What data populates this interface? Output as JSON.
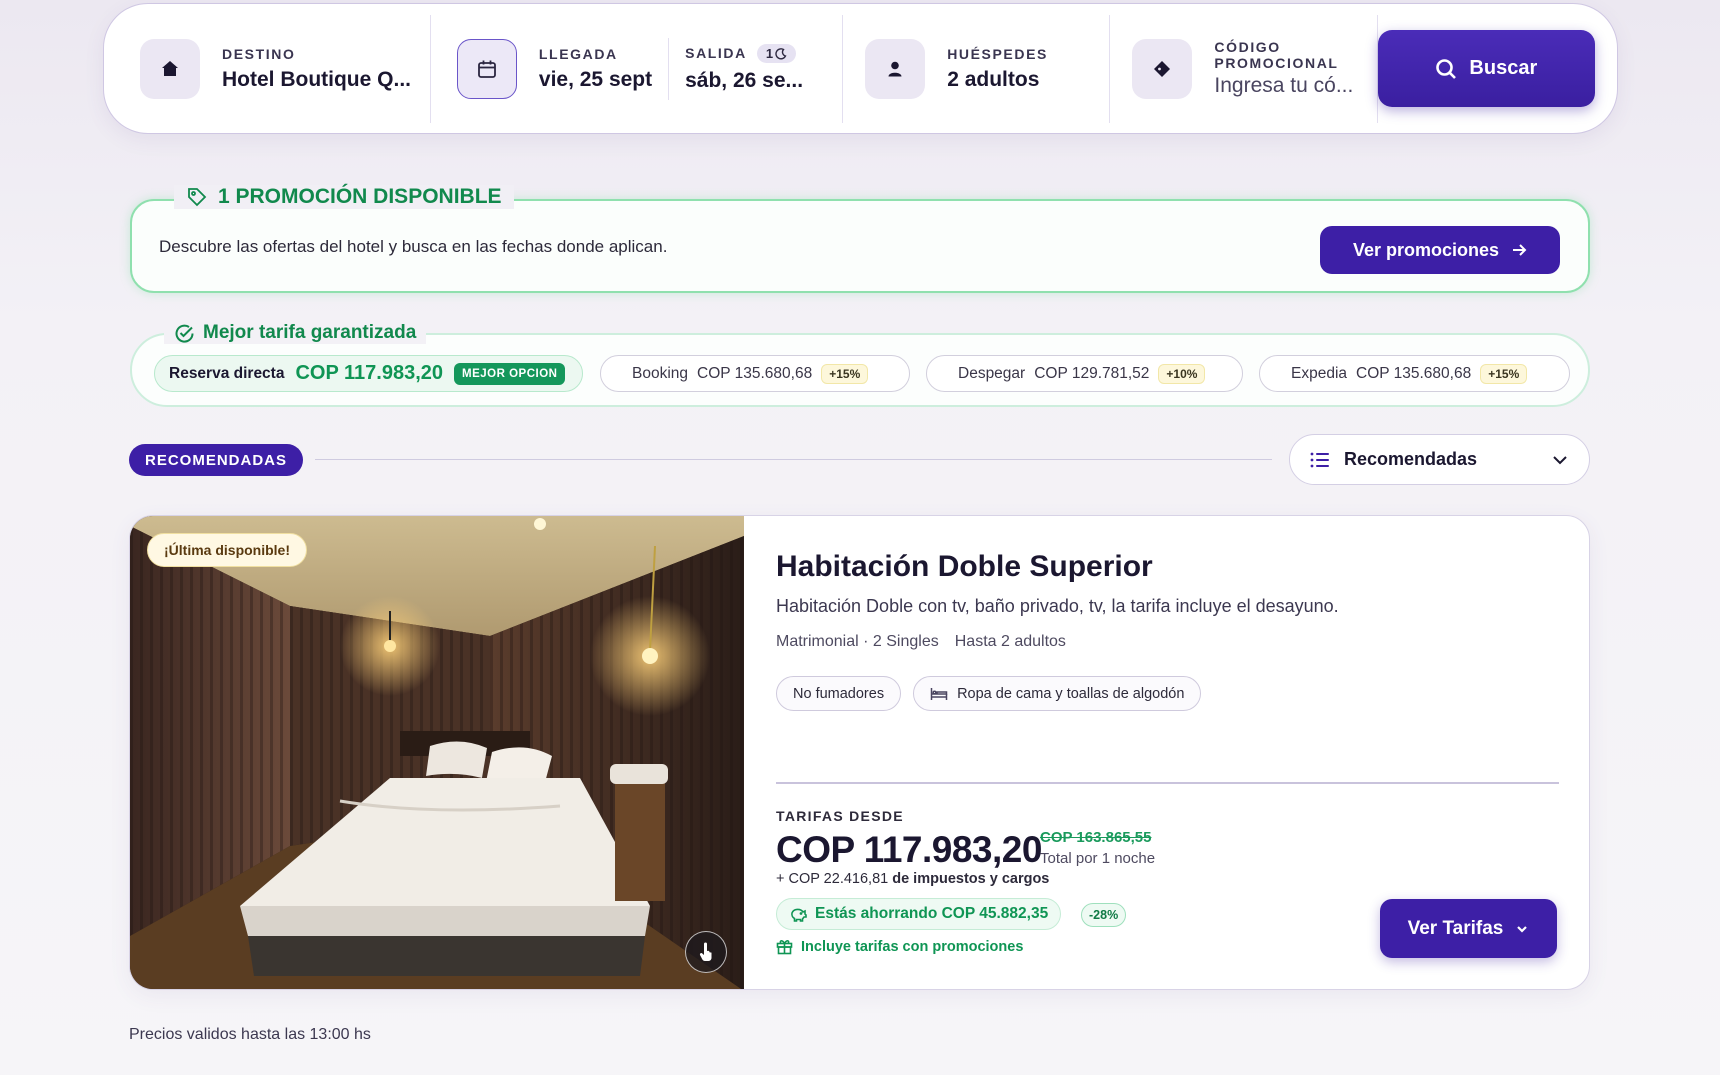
{
  "search": {
    "destination": {
      "label": "DESTINO",
      "value": "Hotel Boutique Q...",
      "icon": "home-icon"
    },
    "arrival": {
      "label": "LLEGADA",
      "value": "vie, 25 sept",
      "icon": "calendar-icon"
    },
    "departure": {
      "label": "SALIDA",
      "value": "sáb, 26 se...",
      "nights": "1",
      "nights_icon": "moon-icon"
    },
    "guests": {
      "label": "HUÉSPEDES",
      "value": "2 adultos",
      "icon": "user-icon"
    },
    "promo_code": {
      "label_line1": "CÓDIGO",
      "label_line2": "PROMOCIONAL",
      "placeholder": "Ingresa tu có...",
      "icon": "tag-icon"
    },
    "button_label": "Buscar"
  },
  "promo_banner": {
    "title": "1 PROMOCIÓN DISPONIBLE",
    "text": "Descubre las ofertas del hotel y busca en las fechas donde aplican.",
    "button_label": "Ver promociones"
  },
  "best_rate": {
    "title": "Mejor tarifa garantizada",
    "direct": {
      "name": "Reserva directa",
      "price": "COP 117.983,20",
      "badge": "MEJOR OPCION"
    },
    "others": [
      {
        "name": "Booking",
        "price": "COP 135.680,68",
        "diff": "+15%"
      },
      {
        "name": "Despegar",
        "price": "COP 129.781,52",
        "diff": "+10%"
      },
      {
        "name": "Expedia",
        "price": "COP 135.680,68",
        "diff": "+15%"
      }
    ]
  },
  "section": {
    "pill": "RECOMENDADAS",
    "sort_selected": "Recomendadas"
  },
  "room": {
    "badge": "¡Última disponible!",
    "title": "Habitación Doble Superior",
    "description": "Habitación Doble con tv, baño privado, tv, la tarifa incluye el desayuno.",
    "beds": "Matrimonial · 2 Singles",
    "capacity": "Hasta 2 adultos",
    "tags": [
      "No fumadores",
      "Ropa de cama y toallas de algodón"
    ],
    "rates_label": "TARIFAS DESDE",
    "price": "COP 117.983,20",
    "old_price": "COP 163.865,55",
    "per_night": "Total por 1 noche",
    "taxes_prefix": "+ COP 22.416,81 ",
    "taxes_suffix": "de impuestos y cargos",
    "saving": "Estás ahorrando COP 45.882,35",
    "discount": "-28%",
    "promo_note": "Incluye tarifas con promociones",
    "button_label": "Ver Tarifas"
  },
  "footer_note": "Precios validos hasta las 13:00 hs",
  "colors": {
    "primary": "#3d1fa6",
    "success": "#0f9554",
    "promo_border": "#8fe0ae"
  }
}
